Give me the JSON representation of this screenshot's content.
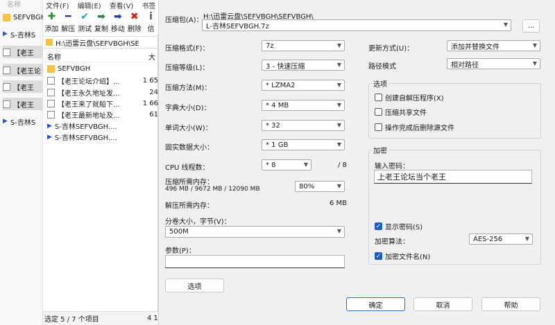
{
  "explorer": {
    "header": "名称",
    "items": [
      {
        "label": "SEFVBGH",
        "kind": "folder"
      },
      {
        "label": "S-吉林S",
        "kind": "arrow"
      },
      {
        "label": "【老王",
        "kind": "doc"
      },
      {
        "label": "【老王论",
        "kind": "doc"
      },
      {
        "label": "【老王",
        "kind": "doc"
      },
      {
        "label": "【老王",
        "kind": "doc"
      },
      {
        "label": "S-吉林S",
        "kind": "arrow"
      }
    ]
  },
  "zip": {
    "menu": [
      "文件(F)",
      "编辑(E)",
      "查看(V)",
      "书签"
    ],
    "tools": [
      {
        "label": "添加",
        "glyph": "✚",
        "color": "#1a9a1a"
      },
      {
        "label": "解压",
        "glyph": "━",
        "color": "#2030b0"
      },
      {
        "label": "测试",
        "glyph": "✔",
        "color": "#1aa0c0"
      },
      {
        "label": "复制",
        "glyph": "➡",
        "color": "#1a8a3a"
      },
      {
        "label": "移动",
        "glyph": "➡",
        "color": "#2040b0"
      },
      {
        "label": "删除",
        "glyph": "✖",
        "color": "#d02020"
      },
      {
        "label": "信",
        "glyph": "i",
        "color": "#555555"
      }
    ],
    "path": "H:\\迅雷云盘\\SEFVBGH\\SE",
    "col_name": "名称",
    "col_size": "大",
    "files": [
      {
        "name": "SEFVBGH",
        "size": "",
        "kind": "folder"
      },
      {
        "name": "【老王论坛介绍】...",
        "size": "1 65",
        "kind": "doc"
      },
      {
        "name": "【老王永久地址发...",
        "size": "24",
        "kind": "doc"
      },
      {
        "name": "【老王来了就船下...",
        "size": "1 66",
        "kind": "doc"
      },
      {
        "name": "【老王最新地址及...",
        "size": "61",
        "kind": "doc"
      },
      {
        "name": "S-吉林SEFVBGH....",
        "size": "",
        "kind": "arrow"
      },
      {
        "name": "S-吉林SEFVBGH....",
        "size": "",
        "kind": "arrow"
      }
    ],
    "status": "选定 5 / 7 个项目",
    "status2": "4 1"
  },
  "dialog": {
    "archive_label": "压缩包(A)：",
    "archive_dir": "H:\\迅雷云盘\\SEFVBGH\\SEFVBGH\\",
    "archive_name": "L-吉林SEFVBGH.7z",
    "browse": "...",
    "format_label": "压缩格式(F)：",
    "format_value": "7z",
    "level_label": "压缩等级(L)：",
    "level_value": "3 - 快速压缩",
    "method_label": "压缩方法(M)：",
    "method_value": "* LZMA2",
    "dict_label": "字典大小(D)：",
    "dict_value": "* 4 MB",
    "word_label": "单词大小(W)：",
    "word_value": "* 32",
    "solid_label": "固实数据大小：",
    "solid_value": "* 1 GB",
    "cpu_label": "CPU 线程数：",
    "cpu_value": "* 8",
    "cpu_total": "/ 8",
    "mem_label": "压缩所需内存：",
    "mem_detail": "496 MB / 9672 MB / 12090 MB",
    "mem_percent": "80%",
    "decomp_label": "解压所需内存：",
    "decomp_value": "6 MB",
    "split_label": "分卷大小，字节(V)：",
    "split_value": "500M",
    "params_label": "参数(P)：",
    "params_value": "",
    "options_btn": "选项",
    "update_label": "更新方式(U)：",
    "update_value": "添加并替换文件",
    "pathmode_label": "路径模式",
    "pathmode_value": "相对路径",
    "opt_group": "选项",
    "opt_sfx": "创建自解压程序(X)",
    "opt_shared": "压缩共享文件",
    "opt_delete": "操作完成后删除源文件",
    "enc_group": "加密",
    "pwd_label": "输入密码：",
    "pwd_value": "上老王论坛当个老王",
    "show_pwd": "显示密码(S)",
    "enc_method_label": "加密算法：",
    "enc_method_value": "AES-256",
    "enc_names": "加密文件名(N)",
    "ok": "确定",
    "cancel": "取消",
    "help": "帮助"
  }
}
